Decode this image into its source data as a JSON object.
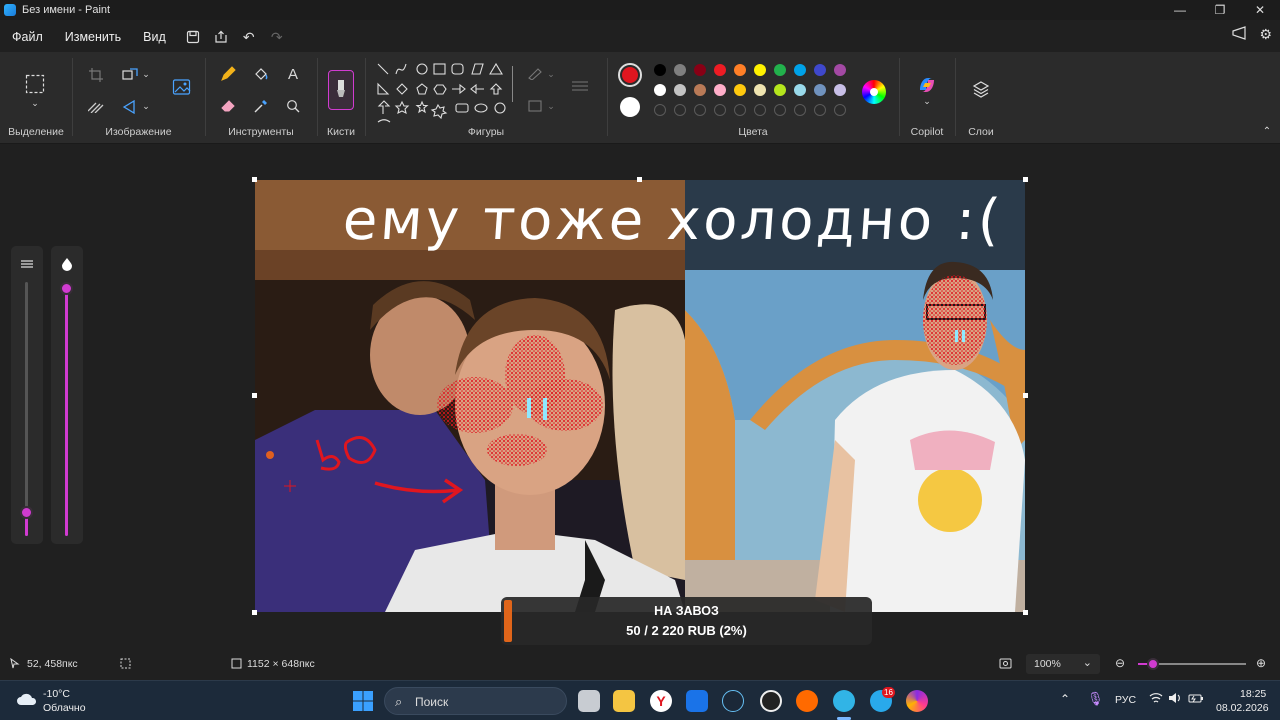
{
  "window": {
    "title": "Без имени - Paint",
    "controls": [
      "—",
      "❐",
      "✕"
    ]
  },
  "menu": {
    "file": "Файл",
    "edit": "Изменить",
    "view": "Вид"
  },
  "ribbon": {
    "groups": {
      "selection": "Выделение",
      "image": "Изображение",
      "tools": "Инструменты",
      "brushes": "Кисти",
      "shapes": "Фигуры",
      "colors": "Цвета",
      "copilot": "Copilot",
      "layers": "Слои"
    },
    "text_tool_glyph": "A",
    "primary_color": "#e0161f",
    "secondary_color": "#ffffff",
    "palette_row1": [
      "#000000",
      "#7f7f7f",
      "#880015",
      "#ed1c24",
      "#ff7f27",
      "#fff200",
      "#22b14c",
      "#00a2e8",
      "#3f48cc",
      "#a349a4"
    ],
    "palette_row2": [
      "#ffffff",
      "#c3c3c3",
      "#b97a57",
      "#ffaec9",
      "#ffc90e",
      "#efe4b0",
      "#b5e61d",
      "#99d9ea",
      "#7092be",
      "#c8bfe7"
    ]
  },
  "canvas": {
    "handwritten_text": "ему тоже холодно :(",
    "scribble_number": "50"
  },
  "donation": {
    "line1": "НА ЗАВОЗ",
    "line2": "50 / 2 220 RUB (2%)",
    "progress_fraction": 0.02
  },
  "status": {
    "cursor_pos": "52, 458пкс",
    "canvas_size": "1152 × 648пкс",
    "zoom": "100%"
  },
  "taskbar": {
    "weather_temp": "-10°C",
    "weather_desc": "Облачно",
    "search_placeholder": "Поиск",
    "lang": "РУС",
    "time": "18:25",
    "date": "08.02.2026",
    "telegram_badge": "16"
  }
}
